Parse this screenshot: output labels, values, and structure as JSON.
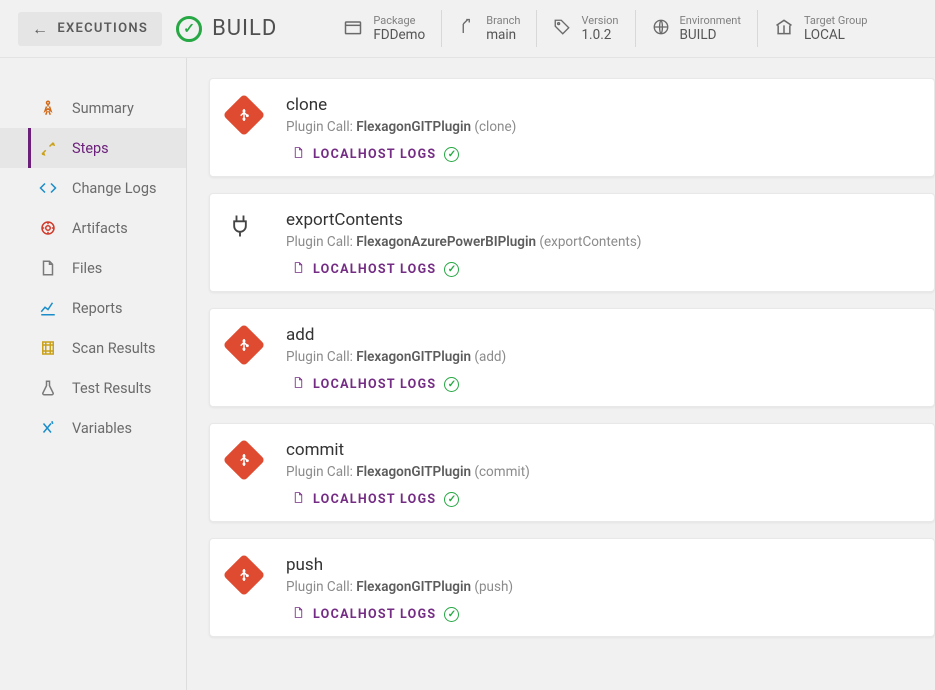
{
  "header": {
    "executions_label": "EXECUTIONS",
    "build_label": "BUILD",
    "meta": [
      {
        "label": "Package",
        "value": "FDDemo"
      },
      {
        "label": "Branch",
        "value": "main"
      },
      {
        "label": "Version",
        "value": "1.0.2"
      },
      {
        "label": "Environment",
        "value": "BUILD"
      },
      {
        "label": "Target Group",
        "value": "LOCAL"
      }
    ]
  },
  "sidebar": {
    "items": [
      {
        "label": "Summary"
      },
      {
        "label": "Steps"
      },
      {
        "label": "Change Logs"
      },
      {
        "label": "Artifacts"
      },
      {
        "label": "Files"
      },
      {
        "label": "Reports"
      },
      {
        "label": "Scan Results"
      },
      {
        "label": "Test Results"
      },
      {
        "label": "Variables"
      }
    ]
  },
  "common": {
    "plugin_call_prefix": "Plugin Call: ",
    "logs_label": "LOCALHOST LOGS"
  },
  "steps": [
    {
      "title": "clone",
      "plugin": "FlexagonGITPlugin",
      "method": "clone",
      "icon": "git"
    },
    {
      "title": "exportContents",
      "plugin": "FlexagonAzurePowerBIPlugin",
      "method": "exportContents",
      "icon": "plug"
    },
    {
      "title": "add",
      "plugin": "FlexagonGITPlugin",
      "method": "add",
      "icon": "git"
    },
    {
      "title": "commit",
      "plugin": "FlexagonGITPlugin",
      "method": "commit",
      "icon": "git"
    },
    {
      "title": "push",
      "plugin": "FlexagonGITPlugin",
      "method": "push",
      "icon": "git"
    }
  ]
}
